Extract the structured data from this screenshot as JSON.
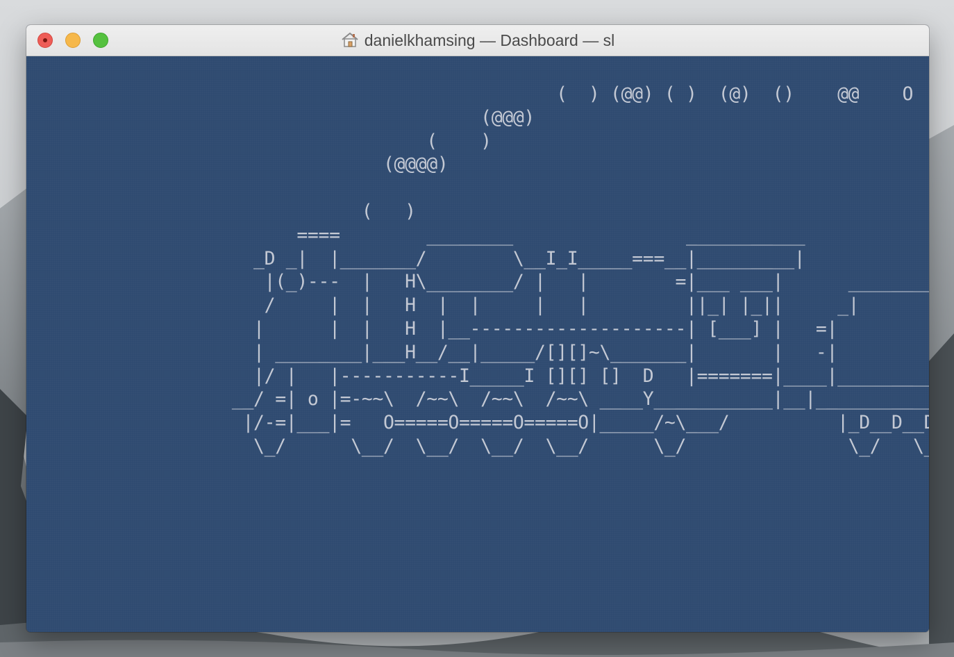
{
  "window": {
    "title": "danielkhamsing — Dashboard — sl",
    "title_icon": "home-icon",
    "buttons": {
      "close": "close-button",
      "minimize": "minimize-button",
      "zoom": "zoom-button"
    }
  },
  "terminal": {
    "background": "#2e4a70",
    "foreground": "#c4c9d4",
    "lines": [
      "                                                 (  ) (@@) ( )  (@)  ()    @@    O     @     O",
      "                                          (@@@)",
      "                                     (    )",
      "                                 (@@@@)",
      "",
      "                               (   )",
      "                         ====        ________                ___________",
      "                     _D _|  |_______/        \\__I_I_____===__|_________|",
      "                      |(_)---  |   H\\________/ |   |        =|___ ___|      _________________",
      "                      /     |  |   H  |  |     |   |         ||_| |_||     _|",
      "                     |      |  |   H  |__--------------------| [___] |   =|",
      "                     | ________|___H__/__|_____/[][]~\\_______|       |   -|",
      "                     |/ |   |-----------I_____I [][] []  D   |=======|____|________________",
      "                   __/ =| o |=-~~\\  /~~\\  /~~\\  /~~\\ ____Y___________|__|__________________",
      "                    |/-=|___|=   O=====O=====O=====O|_____/~\\___/          |_D__D__D_|",
      "                     \\_/      \\__/  \\__/  \\__/  \\__/      \\_/               \\_/   \\_/"
    ]
  }
}
